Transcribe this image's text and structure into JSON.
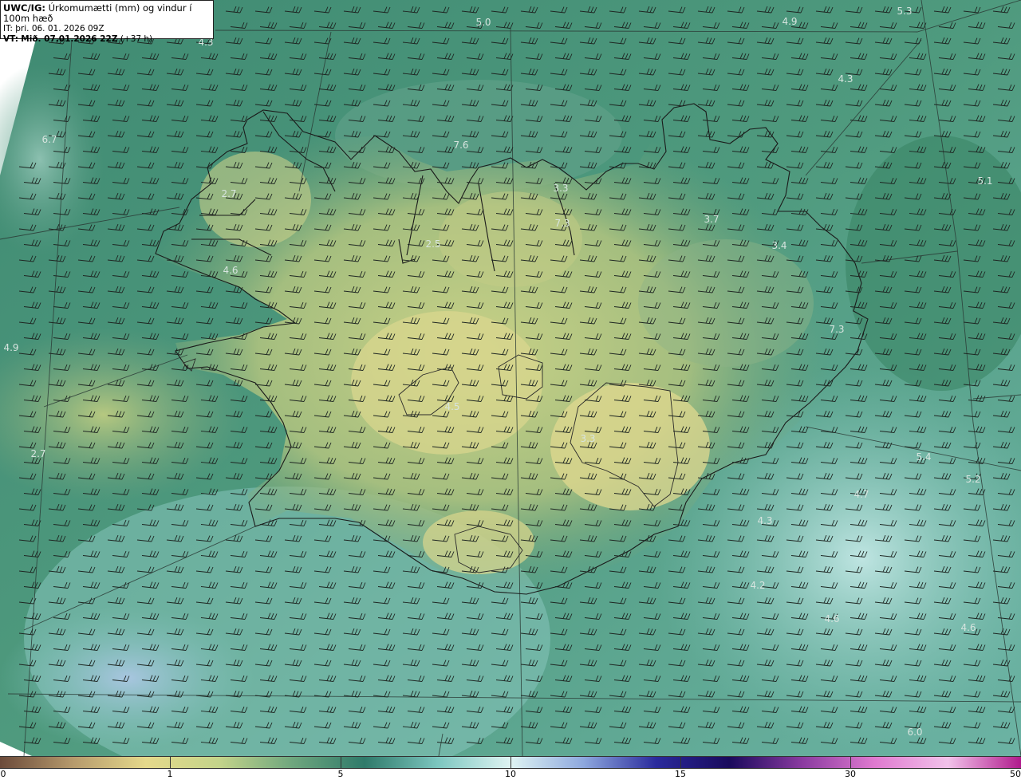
{
  "header": {
    "title_bold": "UWC/IG:",
    "title_rest": "Úrkomumætti (mm) og vindur í 100m hæð",
    "init_label": "IT:",
    "init_value": "þri. 06. 01. 2026 09Z",
    "valid_label": "VT:",
    "valid_value": "Mið. 07.01.2026 22Z",
    "lead_time": "(+37 h)"
  },
  "map_values": [
    {
      "text": "5.0",
      "pos": [
        606,
        28
      ]
    },
    {
      "text": "4.9",
      "pos": [
        990,
        27
      ]
    },
    {
      "text": "5.3",
      "pos": [
        1134,
        14
      ]
    },
    {
      "text": "4.3",
      "pos": [
        258,
        53
      ]
    },
    {
      "text": "4.3",
      "pos": [
        1060,
        99
      ]
    },
    {
      "text": "6.7",
      "pos": [
        62,
        175
      ]
    },
    {
      "text": "7.6",
      "pos": [
        578,
        182
      ]
    },
    {
      "text": "5.1",
      "pos": [
        1235,
        227
      ]
    },
    {
      "text": "2.7",
      "pos": [
        287,
        243
      ]
    },
    {
      "text": "3.3",
      "pos": [
        703,
        236
      ]
    },
    {
      "text": "3.7",
      "pos": [
        892,
        275
      ]
    },
    {
      "text": "7.3",
      "pos": [
        705,
        280
      ]
    },
    {
      "text": "2.5",
      "pos": [
        543,
        306
      ]
    },
    {
      "text": "3.4",
      "pos": [
        977,
        308
      ]
    },
    {
      "text": "4.6",
      "pos": [
        289,
        339
      ]
    },
    {
      "text": "7.3",
      "pos": [
        1049,
        413
      ]
    },
    {
      "text": "4.9",
      "pos": [
        14,
        436
      ]
    },
    {
      "text": "4.5",
      "pos": [
        567,
        510
      ]
    },
    {
      "text": "3.3",
      "pos": [
        737,
        550
      ]
    },
    {
      "text": "2.7",
      "pos": [
        48,
        569
      ]
    },
    {
      "text": "5.4",
      "pos": [
        1158,
        573
      ]
    },
    {
      "text": "5.2",
      "pos": [
        1220,
        601
      ]
    },
    {
      "text": "4.7",
      "pos": [
        1080,
        620
      ]
    },
    {
      "text": "4.3",
      "pos": [
        959,
        653
      ]
    },
    {
      "text": "4.2",
      "pos": [
        950,
        734
      ]
    },
    {
      "text": "4.6",
      "pos": [
        1043,
        776
      ]
    },
    {
      "text": "4.6",
      "pos": [
        1214,
        787
      ]
    },
    {
      "text": "6.0",
      "pos": [
        1147,
        918
      ]
    }
  ],
  "colorbar": {
    "ticks": [
      {
        "label": "0",
        "value": 0
      },
      {
        "label": "1",
        "value": 1
      },
      {
        "label": "5",
        "value": 5
      },
      {
        "label": "10",
        "value": 10
      },
      {
        "label": "15",
        "value": 15
      },
      {
        "label": "30",
        "value": 30
      },
      {
        "label": "50",
        "value": 50
      }
    ],
    "colors": [
      "#6b4a3a",
      "#b69a6c",
      "#e5d98b",
      "#c4d48a",
      "#6fa77e",
      "#2f7a6a",
      "#7cc6bf",
      "#dff4f3",
      "#8ea8de",
      "#2a2a9c",
      "#1a0a5c",
      "#8a3aa0",
      "#e07ad0",
      "#f2c2ea",
      "#b01a8c"
    ]
  }
}
